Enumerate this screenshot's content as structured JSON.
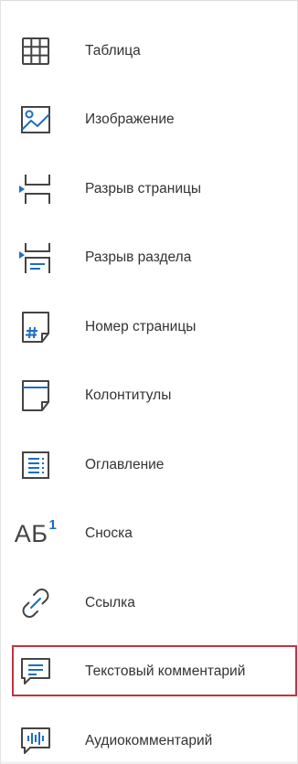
{
  "colors": {
    "icon_stroke": "#444444",
    "icon_accent": "#1a6fc2",
    "text": "#333333",
    "highlight_border": "#c0353f"
  },
  "menu": {
    "items": [
      {
        "label": "Таблица",
        "icon": "table-icon"
      },
      {
        "label": "Изображение",
        "icon": "image-icon"
      },
      {
        "label": "Разрыв страницы",
        "icon": "page-break-icon"
      },
      {
        "label": "Разрыв раздела",
        "icon": "section-break-icon"
      },
      {
        "label": "Номер страницы",
        "icon": "page-number-icon"
      },
      {
        "label": "Колонтитулы",
        "icon": "header-footer-icon"
      },
      {
        "label": "Оглавление",
        "icon": "table-of-contents-icon"
      },
      {
        "label": "Сноска",
        "icon": "footnote-icon",
        "icon_text": "АБ",
        "icon_sup": "1"
      },
      {
        "label": "Ссылка",
        "icon": "link-icon"
      },
      {
        "label": "Текстовый комментарий",
        "icon": "text-comment-icon",
        "highlighted": true
      },
      {
        "label": "Аудиокомментарий",
        "icon": "audio-comment-icon"
      }
    ]
  }
}
